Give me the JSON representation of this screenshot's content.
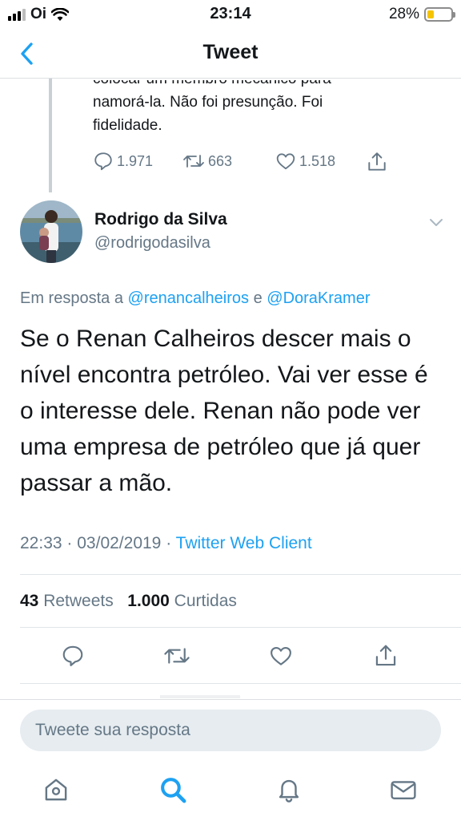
{
  "status_bar": {
    "carrier": "Oi",
    "time": "23:14",
    "battery_text": "28%",
    "battery_level": 0.28
  },
  "nav": {
    "title": "Tweet",
    "back_icon": "chevron-left-icon"
  },
  "parent_tweet": {
    "text_lines": [
      "colocar um membro mecânico para",
      "namorá-la. Não foi presunção. Foi",
      "fidelidade."
    ],
    "replies": "1.971",
    "retweets": "663",
    "likes": "1.518"
  },
  "tweet": {
    "author_name": "Rodrigo da Silva",
    "author_handle": "@rodrigodasilva",
    "reply_prefix": "Em resposta a",
    "reply_mention_1": "@renancalheiros",
    "reply_joiner": "e",
    "reply_mention_2": "@DoraKramer",
    "body": "Se o Renan Calheiros descer mais o nível encontra petróleo. Vai ver esse é o interesse dele. Renan não pode ver uma empresa de petróleo que já quer passar a mão.",
    "time": "22:33",
    "date": "03/02/2019",
    "separator": "·",
    "client": "Twitter Web Client",
    "retweet_count": "43",
    "retweet_label": "Retweets",
    "like_count": "1.000",
    "like_label": "Curtidas"
  },
  "composer": {
    "placeholder": "Tweete sua resposta"
  },
  "tab_bar": {
    "items": [
      "home-icon",
      "search-icon",
      "notifications-icon",
      "messages-icon"
    ],
    "active": "search-icon"
  },
  "colors": {
    "accent": "#1da1f2",
    "secondary_text": "#657786",
    "primary_text": "#14171a",
    "input_bg": "#e6ecf0",
    "battery": "#f5c400"
  }
}
